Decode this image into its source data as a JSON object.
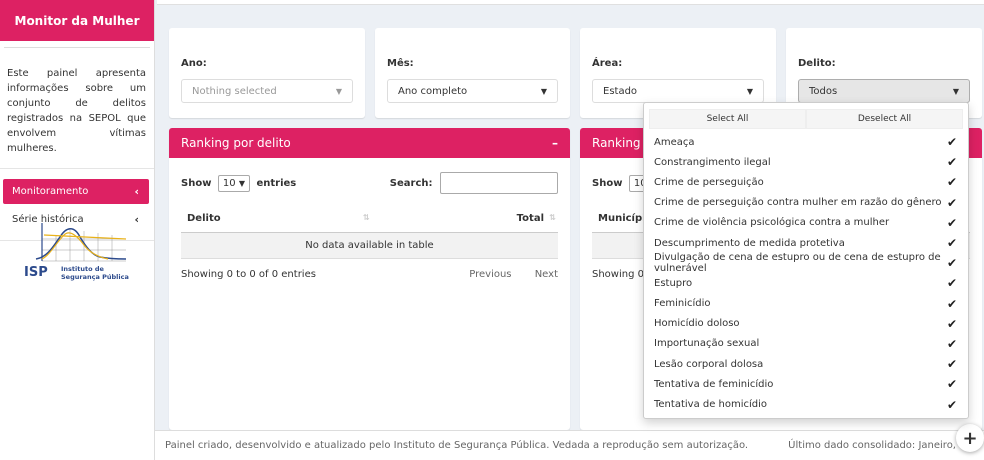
{
  "sidebar": {
    "brand": "Monitor da Mulher",
    "description": "Este painel apresenta informações sobre um conjunto de delitos registrados na SEPOL que envolvem vítimas mulheres.",
    "menu": [
      {
        "label": "Monitoramento",
        "active": true
      },
      {
        "label": "Série histórica",
        "active": false
      }
    ],
    "logo": {
      "abbr": "ISP",
      "line1": "Instituto de",
      "line2": "Segurança Pública"
    }
  },
  "filters": {
    "ano": {
      "label": "Ano:",
      "value": "Nothing selected"
    },
    "mes": {
      "label": "Mês:",
      "value": "Ano completo"
    },
    "area": {
      "label": "Área:",
      "value": "Estado"
    },
    "delito": {
      "label": "Delito:",
      "value": "Todos"
    }
  },
  "ranking_delito": {
    "title": "Ranking por delito",
    "collapse": "–",
    "show": "Show",
    "entries_value": "10",
    "entries": "entries",
    "search_label": "Search:",
    "columns": [
      "Delito",
      "Total"
    ],
    "empty": "No data available in table",
    "info": "Showing 0 to 0 of 0 entries",
    "previous": "Previous",
    "next": "Next"
  },
  "ranking_municipio": {
    "title": "Ranking po",
    "show": "Show",
    "entries_value": "10",
    "column": "Município",
    "info": "Showing 0 t"
  },
  "dropdown": {
    "select_all": "Select All",
    "deselect_all": "Deselect All",
    "options": [
      "Ameaça",
      "Constrangimento ilegal",
      "Crime de perseguição",
      "Crime de perseguição contra mulher em razão do gênero",
      "Crime de violência psicológica contra a mulher",
      "Descumprimento de medida protetiva",
      "Divulgação de cena de estupro ou de cena de estupro de vulnerável",
      "Estupro",
      "Feminicídio",
      "Homicídio doloso",
      "Importunação sexual",
      "Lesão corporal dolosa",
      "Tentativa de feminicídio",
      "Tentativa de homicídio"
    ]
  },
  "footer": {
    "left": "Painel criado, desenvolvido e atualizado pelo Instituto de Segurança Pública. Vedada a reprodução sem autorização.",
    "right": "Último dado consolidado: Janeiro,"
  },
  "fab": "+",
  "colors": {
    "accent": "#dd2163"
  }
}
